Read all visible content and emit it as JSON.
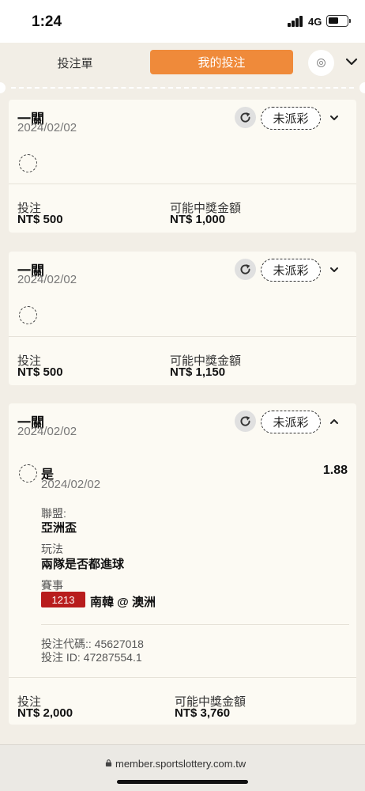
{
  "status_bar": {
    "time": "1:24",
    "network": "4G"
  },
  "tabs": {
    "bet_slip": "投注單",
    "my_bets": "我的投注"
  },
  "colors": {
    "accent": "#ef8a3a",
    "match_badge": "#b81c1c"
  },
  "bets": [
    {
      "type": "一關",
      "date": "2024/02/02",
      "status": "未派彩",
      "stake_label": "投注",
      "stake": "NT$ 500",
      "payout_label": "可能中獎金額",
      "payout": "NT$ 1,000"
    },
    {
      "type": "一關",
      "date": "2024/02/02",
      "status": "未派彩",
      "stake_label": "投注",
      "stake": "NT$ 500",
      "payout_label": "可能中獎金額",
      "payout": "NT$ 1,150"
    },
    {
      "type": "一關",
      "date": "2024/02/02",
      "status": "未派彩",
      "selection": "是",
      "odds": "1.88",
      "selection_date": "2024/02/02",
      "league_label": "聯盟:",
      "league": "亞洲盃",
      "market_label": "玩法",
      "market": "兩隊是否都進球",
      "event_label": "賽事",
      "match_id": "1213",
      "match": "南韓 @ 澳洲",
      "bet_code": "投注代碼:: 45627018",
      "bet_id": "投注 ID: 47287554.1",
      "stake_label": "投注",
      "stake": "NT$ 2,000",
      "payout_label": "可能中獎金額",
      "payout": "NT$ 3,760"
    }
  ],
  "browser": {
    "url": "member.sportslottery.com.tw"
  }
}
